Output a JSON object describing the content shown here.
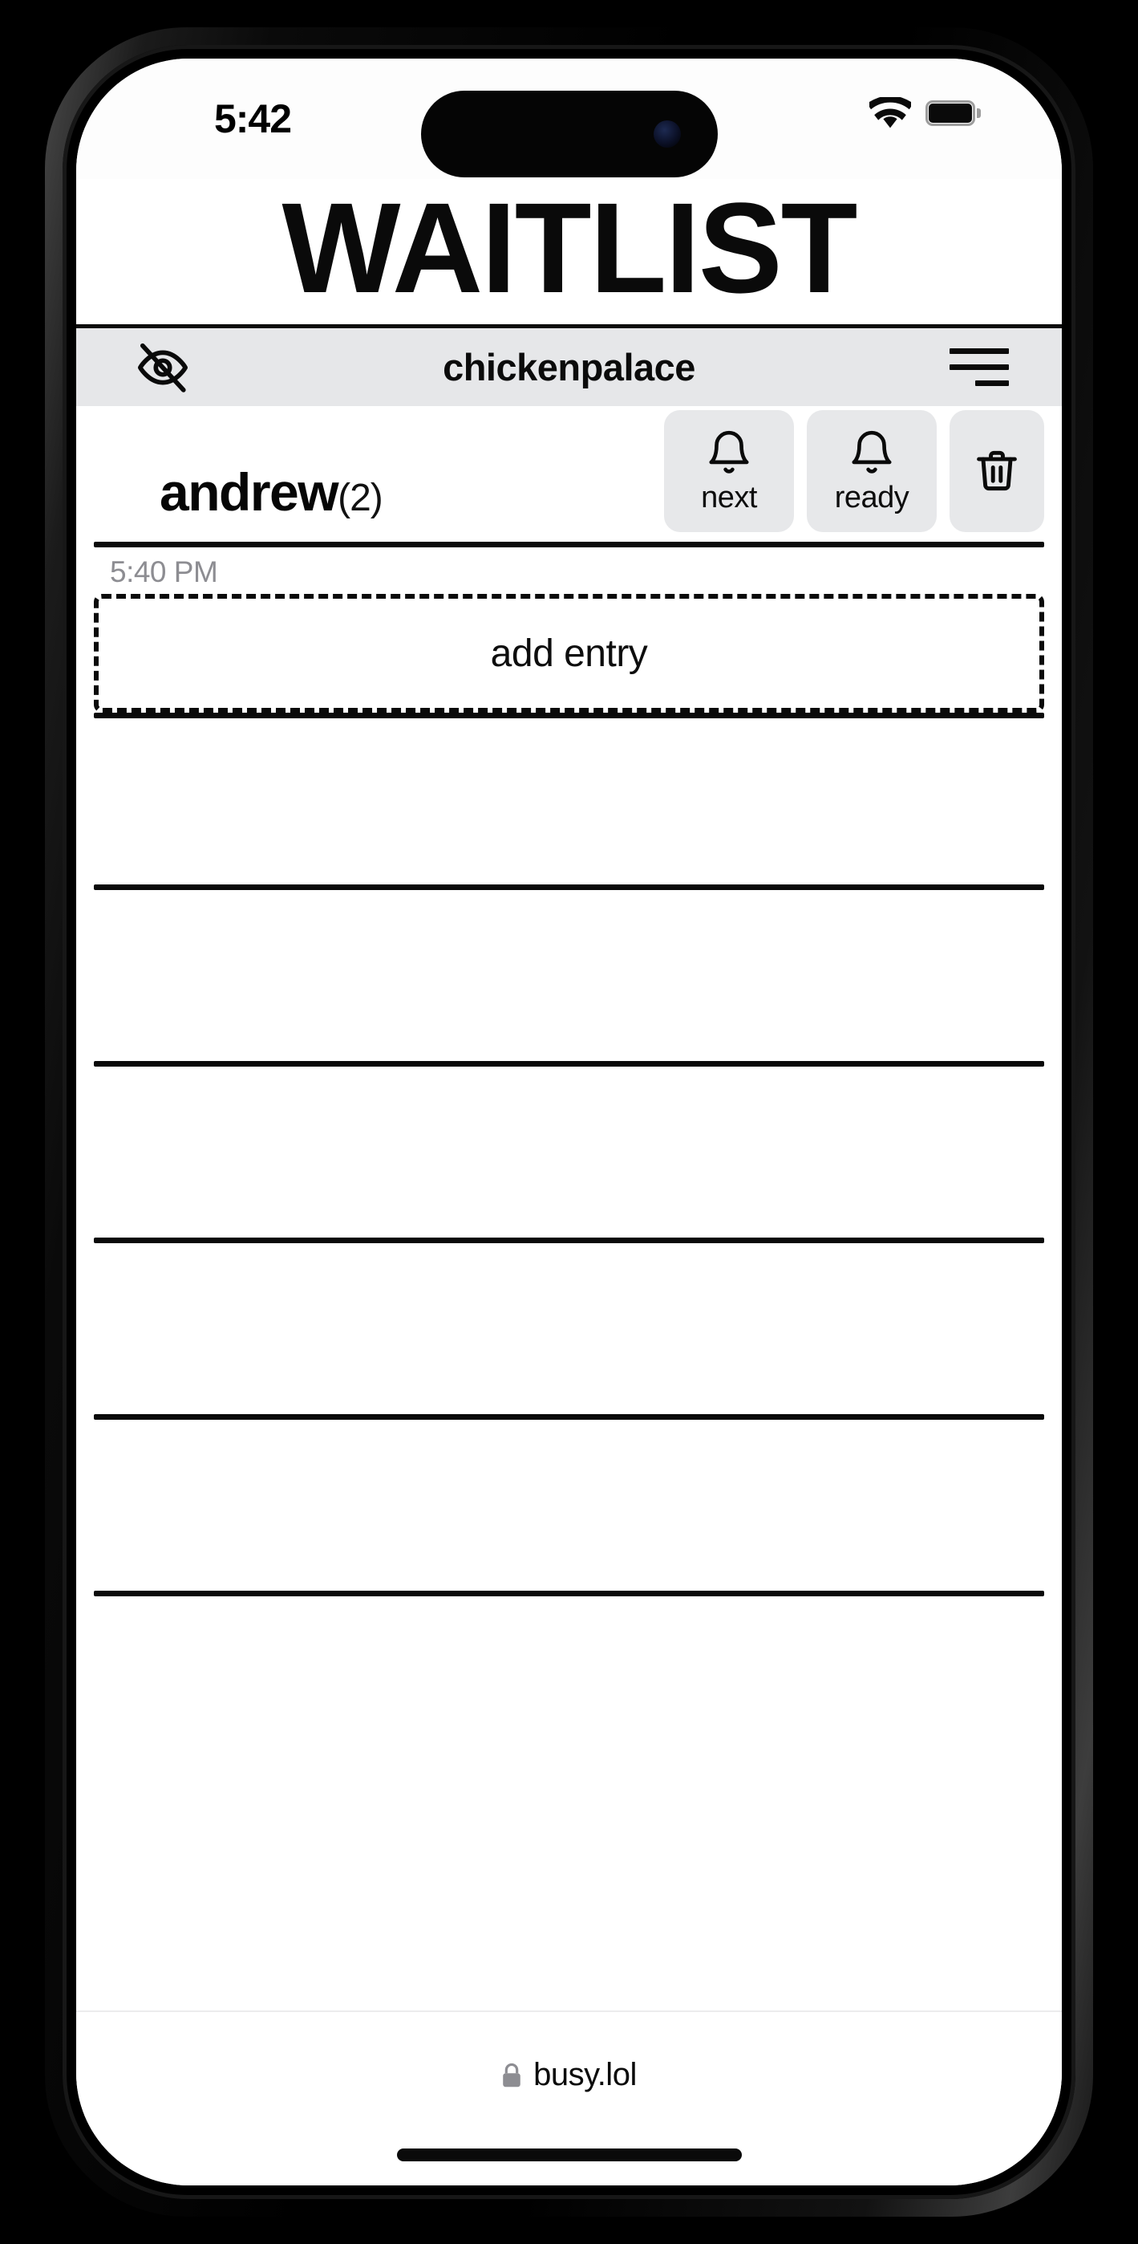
{
  "status_bar": {
    "time": "5:42",
    "wifi_icon": "wifi-icon",
    "battery_icon": "battery-full-icon"
  },
  "page": {
    "title": "WAITLIST"
  },
  "site_toolbar": {
    "hide_icon": "eye-off-icon",
    "site_name": "chickenpalace",
    "menu_icon": "hamburger-menu-icon"
  },
  "queue": {
    "name": "andrew",
    "count_label": "(2)",
    "actions": [
      {
        "id": "next",
        "icon": "bell-icon",
        "label": "next"
      },
      {
        "id": "ready",
        "icon": "bell-icon",
        "label": "ready"
      },
      {
        "id": "delete",
        "icon": "trash-icon",
        "label": ""
      }
    ],
    "entry_time": "5:40 PM",
    "add_entry_label": "add entry",
    "empty_slot_count": 6
  },
  "browser_footer": {
    "lock_icon": "lock-icon",
    "url": "busy.lol"
  },
  "colors": {
    "toolbar_bg": "#e6e7e9",
    "button_bg": "#e7e8ea",
    "rule": "#0a0a0a",
    "muted_text": "#8d8d92"
  }
}
